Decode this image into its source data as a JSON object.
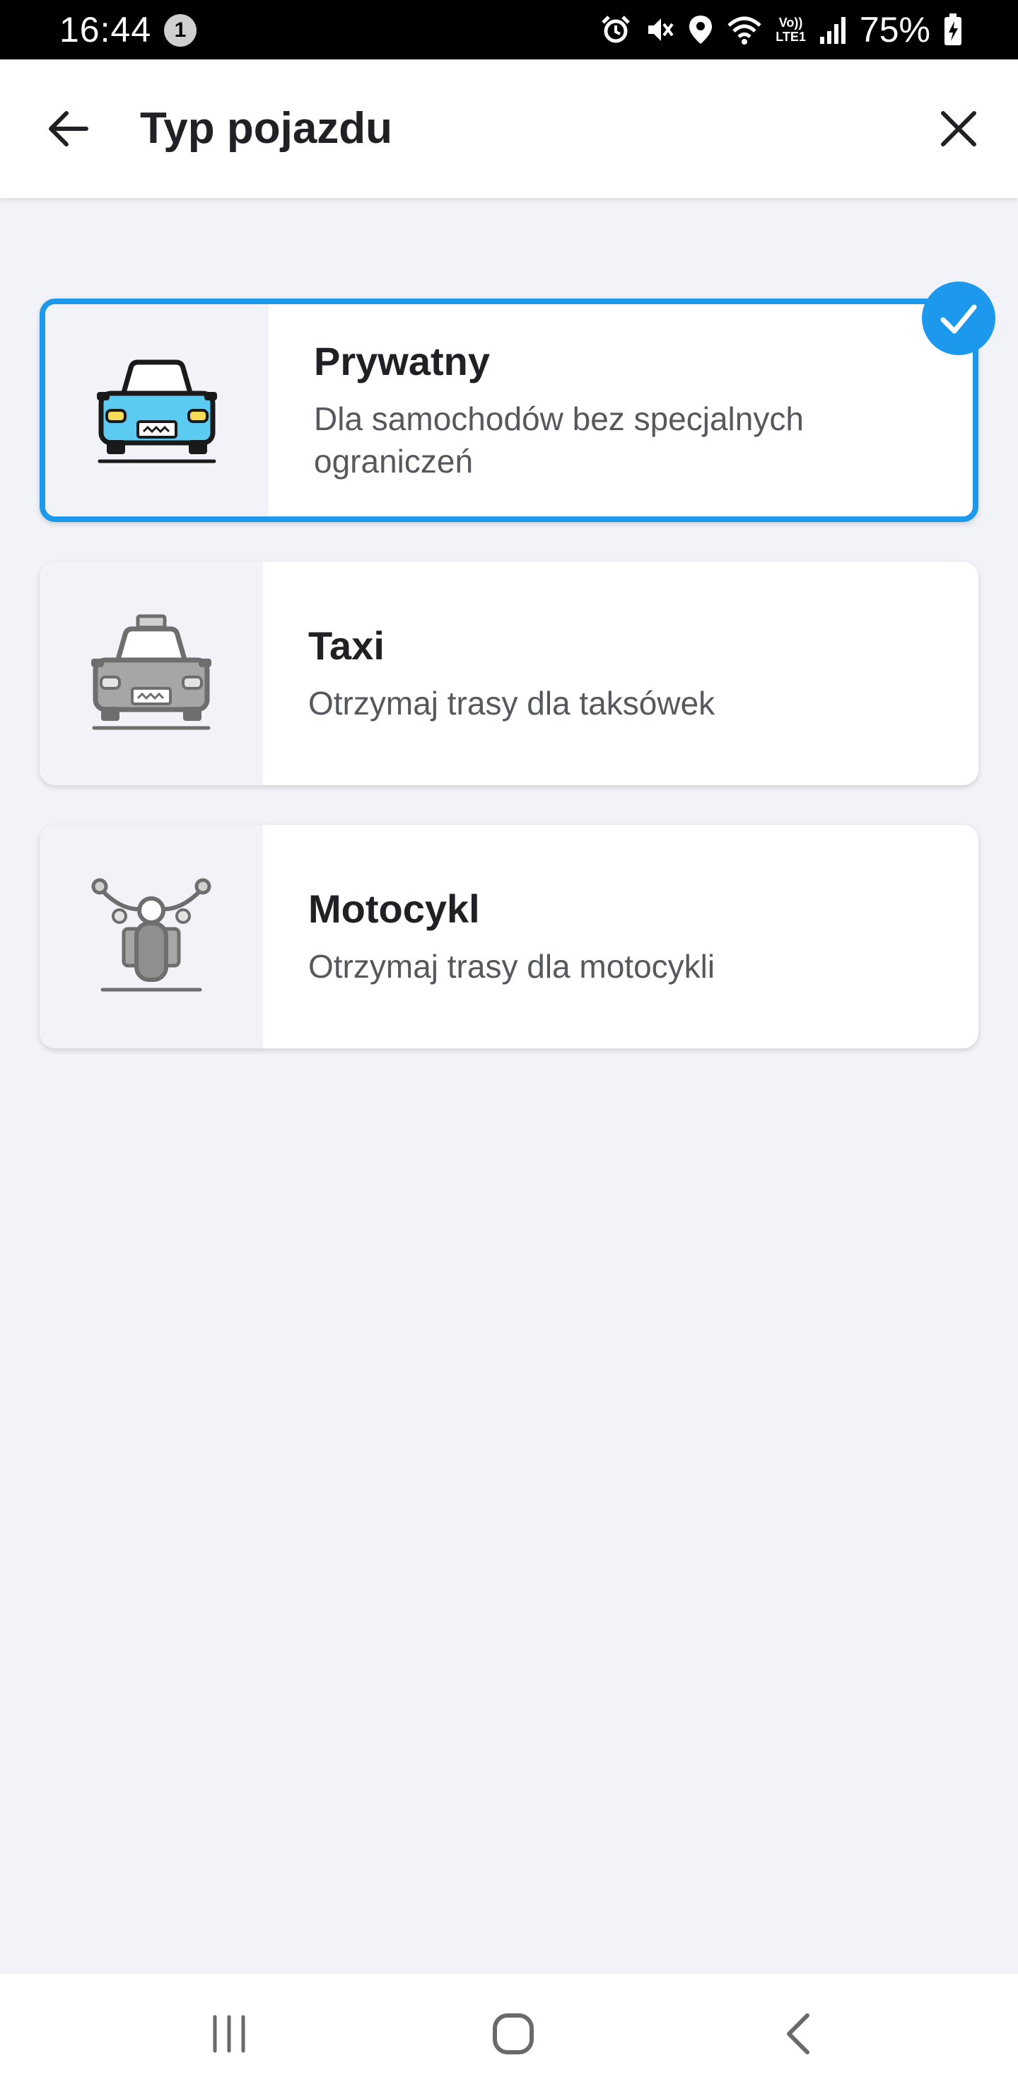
{
  "status_bar": {
    "time": "16:44",
    "notification_count": "1",
    "network_label_top": "Vo))",
    "network_label_bottom": "LTE1",
    "battery_percent": "75%"
  },
  "header": {
    "title": "Typ pojazdu",
    "back_icon": "arrow-left-icon",
    "close_icon": "close-icon"
  },
  "vehicle_types": [
    {
      "title": "Prywatny",
      "description": "Dla samochodów bez specjalnych ograniczeń",
      "icon": "car-icon",
      "selected": true
    },
    {
      "title": "Taxi",
      "description": "Otrzymaj trasy dla taksówek",
      "icon": "taxi-icon",
      "selected": false
    },
    {
      "title": "Motocykl",
      "description": "Otrzymaj trasy dla motocykli",
      "icon": "motorcycle-icon",
      "selected": false
    }
  ],
  "colors": {
    "accent": "#1c98ec",
    "background": "#f1f3f8",
    "card": "#ffffff",
    "car_body": "#5ccbf1",
    "inactive_vehicle": "#a6a6a6"
  }
}
